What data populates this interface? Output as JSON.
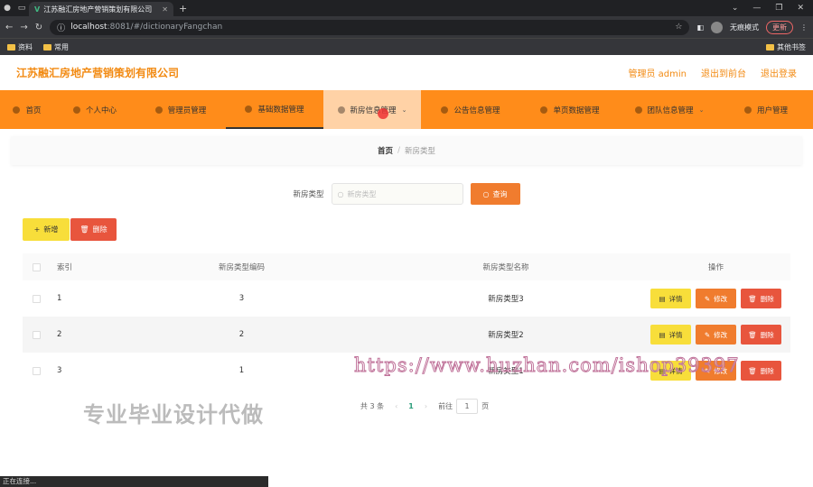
{
  "browser": {
    "tab_title": "江苏融汇房地产营销策划有限公司",
    "url_host": "localhost",
    "url_path": ":8081/#/dictionaryFangchan",
    "profile": "无痕模式",
    "update": "更新",
    "bookmarks": [
      "资料",
      "常用"
    ],
    "other_bookmarks": "其他书签",
    "status_text": "正在连接..."
  },
  "header": {
    "brand": "江苏融汇房地产营销策划有限公司",
    "admin": "管理员 admin",
    "back_front": "退出到前台",
    "logout": "退出登录"
  },
  "nav": [
    {
      "label": "首页"
    },
    {
      "label": "个人中心"
    },
    {
      "label": "管理员管理"
    },
    {
      "label": "基础数据管理"
    },
    {
      "label": "新房信息管理"
    },
    {
      "label": "公告信息管理"
    },
    {
      "label": "单页数据管理"
    },
    {
      "label": "团队信息管理"
    },
    {
      "label": "用户管理"
    }
  ],
  "breadcrumb": {
    "home": "首页",
    "sep": "/",
    "current": "新房类型"
  },
  "search": {
    "label": "新房类型",
    "placeholder": "新房类型",
    "query_button": "查询"
  },
  "toolbar": {
    "add": "新增",
    "delete": "删除"
  },
  "table": {
    "headers": [
      "索引",
      "新房类型编码",
      "新房类型名称",
      "操作"
    ],
    "rows": [
      {
        "index": "1",
        "code": "3",
        "name": "新房类型3"
      },
      {
        "index": "2",
        "code": "2",
        "name": "新房类型2"
      },
      {
        "index": "3",
        "code": "1",
        "name": "新房类型1"
      }
    ],
    "row_actions": {
      "detail": "详情",
      "edit": "修改",
      "delete": "删除"
    }
  },
  "pager": {
    "total": "共 3 条",
    "current_page": "1",
    "goto": "前往",
    "goto_value": "1",
    "page_unit": "页"
  },
  "overlay": {
    "watermark": "https://www.huzhan.com/ishop39397",
    "promo": "专业毕业设计代做"
  },
  "colors": {
    "accent": "#ff8c1a",
    "brand_text": "#f28a12",
    "query": "#f07c2e",
    "add": "#f8de3a",
    "delete": "#e8553d",
    "pager_active": "#2a9d7a"
  }
}
